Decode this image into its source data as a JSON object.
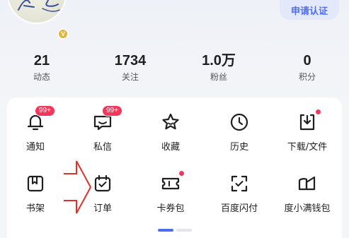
{
  "profile": {
    "vip_badge": "V",
    "verify_label": "申请认证"
  },
  "stats": [
    {
      "value": "21",
      "label": "动态"
    },
    {
      "value": "1734",
      "label": "关注"
    },
    {
      "value": "1.0万",
      "label": "粉丝"
    },
    {
      "value": "0",
      "label": "积分"
    }
  ],
  "shortcuts": [
    {
      "label": "通知",
      "icon": "bell-icon",
      "badge": "99+"
    },
    {
      "label": "私信",
      "icon": "message-icon",
      "badge": "99+"
    },
    {
      "label": "收藏",
      "icon": "star-icon"
    },
    {
      "label": "历史",
      "icon": "clock-icon"
    },
    {
      "label": "下载/文件",
      "icon": "download-icon",
      "dot": true
    },
    {
      "label": "书架",
      "icon": "bookshelf-icon"
    },
    {
      "label": "订单",
      "icon": "order-icon"
    },
    {
      "label": "卡券包",
      "icon": "coupon-icon",
      "dot": true
    },
    {
      "label": "百度闪付",
      "icon": "scan-pay-icon"
    },
    {
      "label": "度小满钱包",
      "icon": "wallet-icon"
    }
  ],
  "pager": {
    "pages": 2,
    "active": 1
  },
  "colors": {
    "accent": "#4e6ef2",
    "badge": "#f5365c",
    "annotation_arrow": "#e0302a"
  }
}
